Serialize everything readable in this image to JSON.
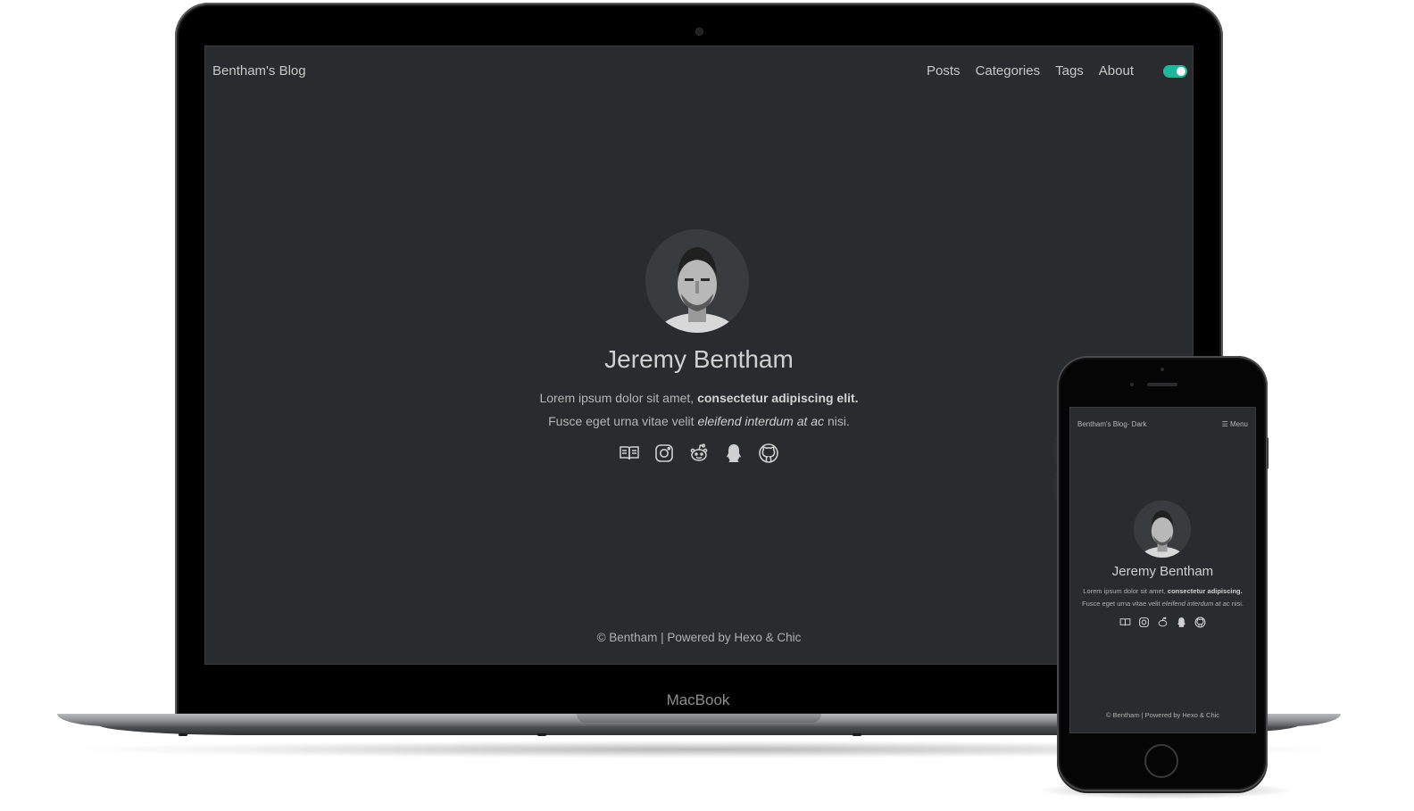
{
  "laptop": {
    "device_label": "MacBook",
    "site_title": "Bentham's Blog",
    "nav": [
      {
        "label": "Posts"
      },
      {
        "label": "Categories"
      },
      {
        "label": "Tags"
      },
      {
        "label": "About"
      }
    ],
    "dark_mode_toggle": {
      "state": "on",
      "color": "#1fb79a"
    },
    "profile": {
      "name": "Jeremy Bentham",
      "desc_line1_plain": "Lorem ipsum dolor sit amet, ",
      "desc_line1_bold": "consectetur adipiscing elit.",
      "desc_line2_plain": "Fusce eget urna vitae velit ",
      "desc_line2_italic": "eleifend interdum at ac",
      "desc_line2_tail": " nisi.",
      "social_icons": [
        "book-icon",
        "instagram-icon",
        "reddit-icon",
        "qq-icon",
        "github-icon"
      ]
    },
    "footer": "© Bentham | Powered by Hexo & Chic"
  },
  "phone": {
    "site_title": "Bentham's Blog· Dark",
    "menu_label": "☰ Menu",
    "profile": {
      "name": "Jeremy Bentham",
      "desc_line1_plain": "Lorem ipsum dolor sit amet, ",
      "desc_line1_bold": "consectetur adipiscing.",
      "desc_line2_plain": "Fusce eget urna vitae velit ",
      "desc_line2_italic": "eleifend interdum at ac",
      "desc_line2_tail": " nisi.",
      "social_icons": [
        "book-icon",
        "instagram-icon",
        "reddit-icon",
        "qq-icon",
        "github-icon"
      ]
    },
    "footer": "© Bentham | Powered by Hexo & Chic"
  },
  "colors": {
    "page_bg": "#ffffff",
    "screen_bg": "#2a2b2f",
    "device_frame": "#000000",
    "text_primary": "#c8c8c8",
    "accent": "#1fb79a"
  }
}
